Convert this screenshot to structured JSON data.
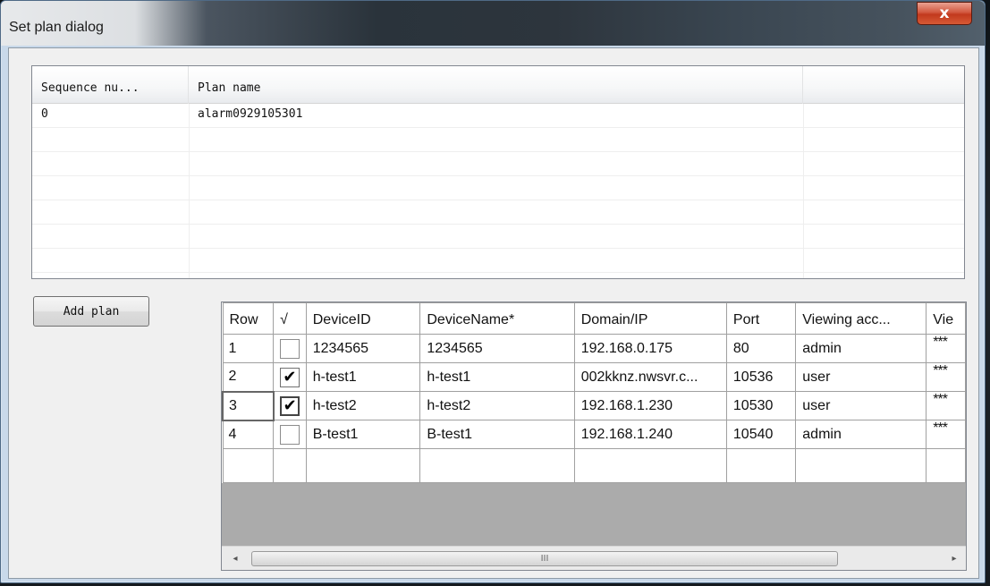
{
  "window": {
    "title": "Set plan dialog",
    "close_label": "x"
  },
  "plan_list": {
    "columns": [
      "Sequence nu...",
      "Plan name"
    ],
    "rows": [
      {
        "sequence": "0",
        "plan_name": "alarm0929105301"
      }
    ]
  },
  "add_plan_label": "Add plan",
  "device_grid": {
    "columns": [
      "Row",
      "√",
      "DeviceID",
      "DeviceName*",
      "Domain/IP",
      "Port",
      "Viewing acc...",
      "Vie"
    ],
    "rows": [
      {
        "row": "1",
        "checked": false,
        "device_id": "1234565",
        "device_name": "1234565",
        "domain_ip": "192.168.0.175",
        "port": "80",
        "viewing_account": "admin",
        "viewing_password": "***"
      },
      {
        "row": "2",
        "checked": true,
        "device_id": "h-test1",
        "device_name": "h-test1",
        "domain_ip": "002kknz.nwsvr.c...",
        "port": "10536",
        "viewing_account": "user",
        "viewing_password": "***"
      },
      {
        "row": "3",
        "checked": true,
        "device_id": "h-test2",
        "device_name": "h-test2",
        "domain_ip": "192.168.1.230",
        "port": "10530",
        "viewing_account": "user",
        "viewing_password": "***"
      },
      {
        "row": "4",
        "checked": false,
        "device_id": "B-test1",
        "device_name": "B-test1",
        "domain_ip": "192.168.1.240",
        "port": "10540",
        "viewing_account": "admin",
        "viewing_password": "***"
      }
    ],
    "checkmark_glyph": "✔"
  },
  "scrollbar": {
    "left_arrow": "◂",
    "right_arrow": "▸",
    "grip": "III"
  }
}
